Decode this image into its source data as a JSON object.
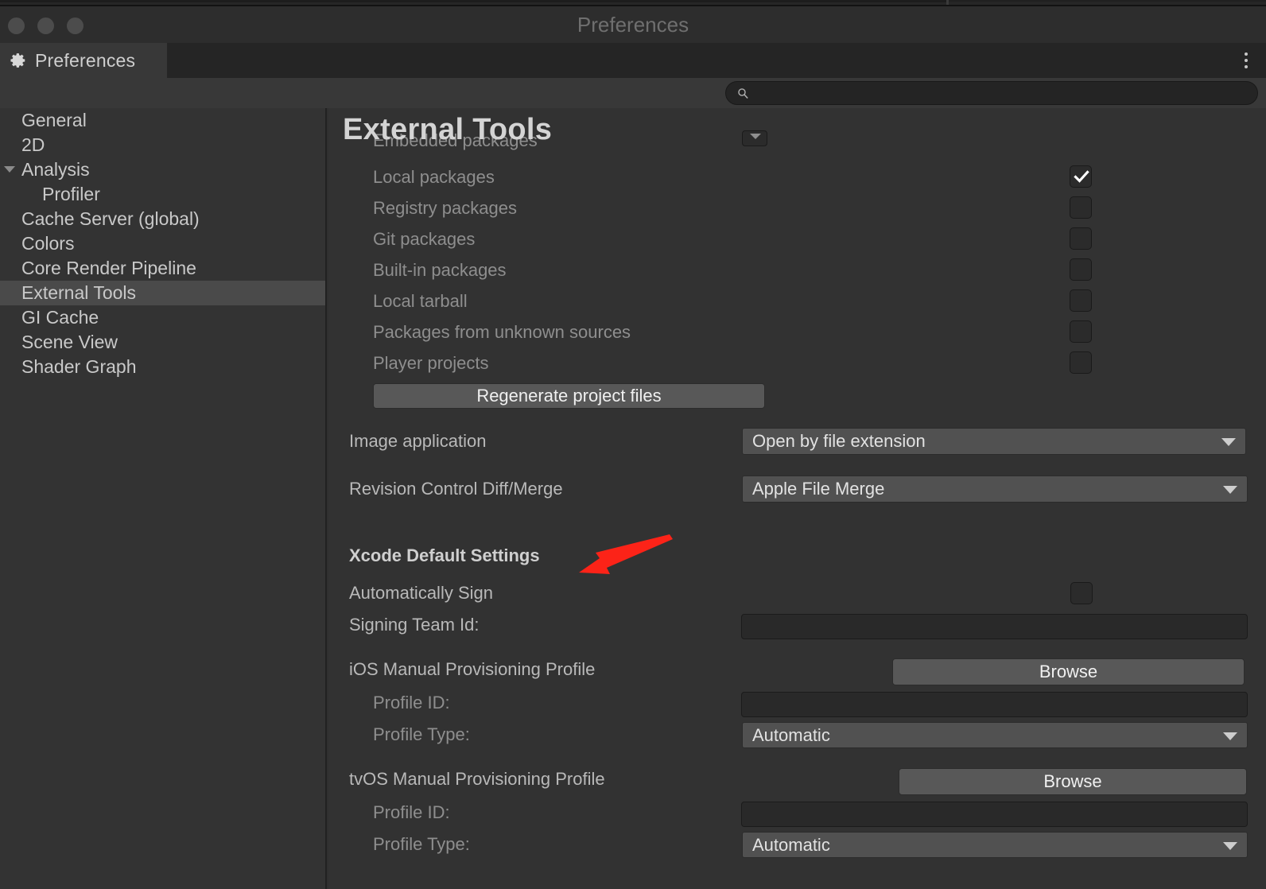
{
  "window": {
    "title": "Preferences",
    "traffic_lights": [
      "close",
      "minimize",
      "maximize"
    ]
  },
  "tab": {
    "label": "Preferences",
    "icon": "gear-icon"
  },
  "overflow_menu": {
    "icon": "kebab-menu-icon"
  },
  "search": {
    "icon": "search-icon",
    "value": "",
    "placeholder": ""
  },
  "sidebar": {
    "items": [
      {
        "label": "General",
        "indent": false,
        "twisty": false,
        "selected": false
      },
      {
        "label": "2D",
        "indent": false,
        "twisty": false,
        "selected": false
      },
      {
        "label": "Analysis",
        "indent": false,
        "twisty": true,
        "selected": false
      },
      {
        "label": "Profiler",
        "indent": true,
        "twisty": false,
        "selected": false
      },
      {
        "label": "Cache Server (global)",
        "indent": false,
        "twisty": false,
        "selected": false
      },
      {
        "label": "Colors",
        "indent": false,
        "twisty": false,
        "selected": false
      },
      {
        "label": "Core Render Pipeline",
        "indent": false,
        "twisty": false,
        "selected": false
      },
      {
        "label": "External Tools",
        "indent": false,
        "twisty": false,
        "selected": true
      },
      {
        "label": "GI Cache",
        "indent": false,
        "twisty": false,
        "selected": false
      },
      {
        "label": "Scene View",
        "indent": false,
        "twisty": false,
        "selected": false
      },
      {
        "label": "Shader Graph",
        "indent": false,
        "twisty": false,
        "selected": false
      }
    ]
  },
  "main": {
    "title": "External Tools",
    "clipped_row": {
      "label": "Embedded packages",
      "widget": "collapsed-dropdown"
    },
    "package_checkboxes": [
      {
        "label": "Local packages",
        "checked": true
      },
      {
        "label": "Registry packages",
        "checked": false
      },
      {
        "label": "Git packages",
        "checked": false
      },
      {
        "label": "Built-in packages",
        "checked": false
      },
      {
        "label": "Local tarball",
        "checked": false
      },
      {
        "label": "Packages from unknown sources",
        "checked": false
      },
      {
        "label": "Player projects",
        "checked": false
      }
    ],
    "regenerate_button": "Regenerate project files",
    "image_application": {
      "label": "Image application",
      "value": "Open by file extension"
    },
    "revision_control": {
      "label": "Revision Control Diff/Merge",
      "value": "Apple File Merge"
    },
    "xcode_section": {
      "heading": "Xcode Default Settings",
      "automatically_sign": {
        "label": "Automatically Sign",
        "checked": false
      },
      "signing_team_id": {
        "label": "Signing Team Id:",
        "value": "",
        "placeholder": ""
      }
    },
    "ios_profile": {
      "heading": "iOS Manual Provisioning Profile",
      "browse_label": "Browse",
      "profile_id": {
        "label": "Profile ID:",
        "value": "",
        "placeholder": ""
      },
      "profile_type": {
        "label": "Profile Type:",
        "value": "Automatic"
      }
    },
    "tvos_profile": {
      "heading": "tvOS Manual Provisioning Profile",
      "browse_label": "Browse",
      "profile_id": {
        "label": "Profile ID:",
        "value": "",
        "placeholder": ""
      },
      "profile_type": {
        "label": "Profile Type:",
        "value": "Automatic"
      }
    }
  },
  "annotation": {
    "type": "arrow",
    "color": "#fc2318",
    "points_to": "Xcode Default Settings"
  },
  "colors": {
    "window_bg": "#303030",
    "titlebar": "#2d2d2d",
    "tabstrip": "#252525",
    "tab_active": "#383838",
    "sidebar": "#333333",
    "sidebar_selected": "#4a4a4a",
    "main_bg": "#323232",
    "button": "#585858",
    "dropdown": "#515151",
    "field": "#292929",
    "text": "#b9b9b9",
    "text_bright": "#e2e2e2",
    "accent_annotation": "#fc2318"
  }
}
